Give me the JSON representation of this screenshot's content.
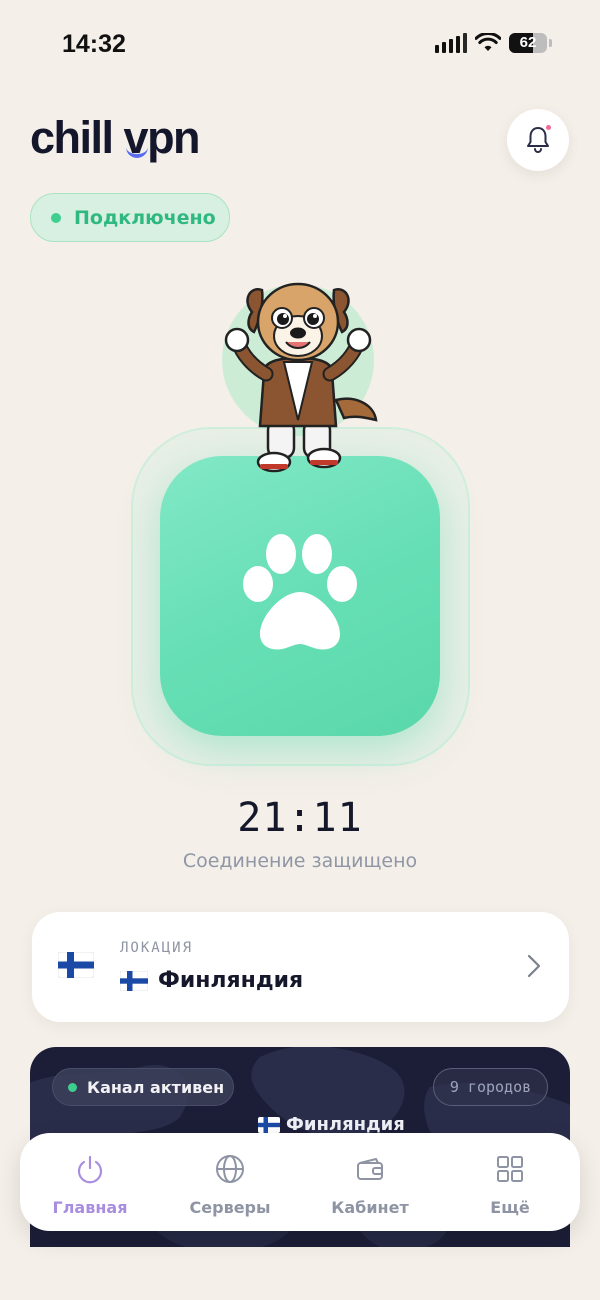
{
  "status_bar": {
    "time": "14:32",
    "battery": "62",
    "battery_level": 0.62,
    "icons": [
      "signal-icon",
      "wifi-icon",
      "battery-icon"
    ]
  },
  "header": {
    "logo_part1": "chill ",
    "logo_v": "v",
    "logo_part2": "pn",
    "notification_icon": "bell-icon"
  },
  "connection": {
    "status": "Подключено",
    "timer": "21:11",
    "secure_text": "Соединение защищено",
    "button_icon": "paw-icon"
  },
  "location": {
    "label": "ЛОКАЦИЯ",
    "country": "Финляндия",
    "flag": "finland-flag"
  },
  "map": {
    "channel_status": "Канал активен",
    "cities": "9 городов",
    "country": "Финляндия"
  },
  "nav": {
    "items": [
      {
        "label": "Главная",
        "icon": "power-icon",
        "active": true
      },
      {
        "label": "Серверы",
        "icon": "globe-icon",
        "active": false
      },
      {
        "label": "Кабинет",
        "icon": "wallet-icon",
        "active": false
      },
      {
        "label": "Ещё",
        "icon": "grid-icon",
        "active": false
      }
    ]
  },
  "colors": {
    "background": "#f4efe8",
    "accent_green": "#67dfb6",
    "status_green": "#3ecf8e",
    "nav_active": "#a98de0",
    "map_bg": "#1c1e38"
  }
}
